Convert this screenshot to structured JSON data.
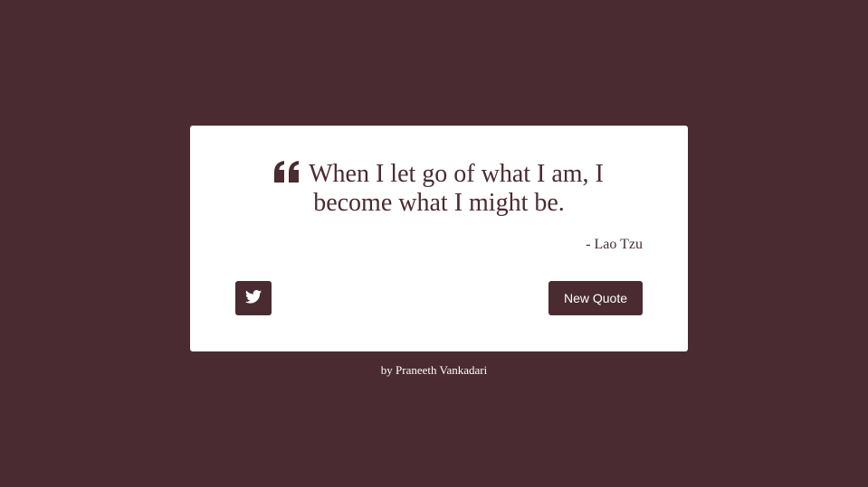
{
  "colors": {
    "background": "#4a2b31",
    "card": "#ffffff",
    "accent": "#4a2b31",
    "button_text": "#ffffff"
  },
  "quote": {
    "icon": "quote-left-icon",
    "text": "When I let go of what I am, I become what I might be.",
    "author": "- Lao Tzu"
  },
  "actions": {
    "tweet_icon": "twitter-icon",
    "new_quote_label": "New Quote"
  },
  "footer": {
    "credit": "by Praneeth Vankadari"
  }
}
